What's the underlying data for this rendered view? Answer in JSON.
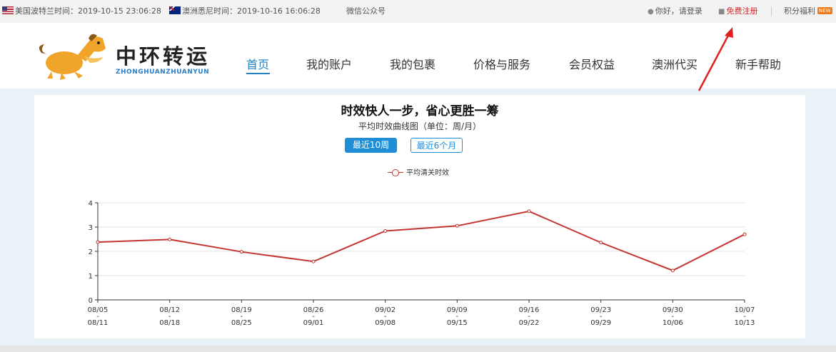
{
  "topbar": {
    "us_time": "美国波特兰时间：2019-10-15 23:06:28",
    "au_time": "澳洲悉尼时间：2019-10-16 16:06:28",
    "wechat": "微信公众号",
    "login": "你好，请登录",
    "register": "免费注册",
    "points": "积分福利",
    "new_badge": "NEW"
  },
  "logo": {
    "title": "中环转运",
    "subtitle": "ZHONGHUANZHUANYUN"
  },
  "nav": [
    "首页",
    "我的账户",
    "我的包裹",
    "价格与服务",
    "会员权益",
    "澳洲代买",
    "新手帮助"
  ],
  "panel": {
    "title": "时效快人一步，省心更胜一筹",
    "subtitle": "平均时效曲线图（单位：周/月）",
    "btn_weeks": "最近10周",
    "btn_months": "最近6个月"
  },
  "chart_data": {
    "type": "line",
    "categories": [
      "08/05-08/11",
      "08/12-08/18",
      "08/19-08/25",
      "08/26-09/01",
      "09/02-09/08",
      "09/09-09/15",
      "09/16-09/22",
      "09/23-09/29",
      "09/30-10/06",
      "10/07-10/13"
    ],
    "tick_labels": [
      [
        "08/05",
        "-",
        "08/11"
      ],
      [
        "08/12",
        "-",
        "08/18"
      ],
      [
        "08/19",
        "-",
        "08/25"
      ],
      [
        "08/26",
        "-",
        "09/01"
      ],
      [
        "09/02",
        "-",
        "09/08"
      ],
      [
        "09/09",
        "-",
        "09/15"
      ],
      [
        "09/16",
        "-",
        "09/22"
      ],
      [
        "09/23",
        "-",
        "09/29"
      ],
      [
        "09/30",
        "-",
        "10/06"
      ],
      [
        "10/07",
        "-",
        "10/13"
      ]
    ],
    "series": [
      {
        "name": "平均清关时效",
        "values": [
          2.38,
          2.49,
          1.98,
          1.58,
          2.84,
          3.05,
          3.65,
          2.36,
          1.21,
          2.7
        ]
      }
    ],
    "ylim": [
      0,
      4
    ],
    "yticks": [
      0,
      1,
      2,
      3,
      4
    ],
    "grid": true,
    "legend": "top-center",
    "line_color": "#c23531"
  }
}
